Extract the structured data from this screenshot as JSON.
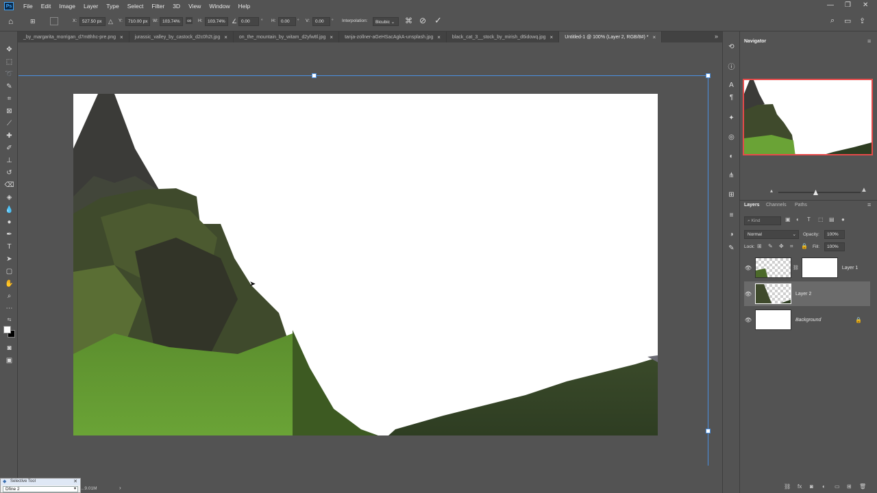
{
  "app": {
    "logo_text": "Ps"
  },
  "menu": [
    "File",
    "Edit",
    "Image",
    "Layer",
    "Type",
    "Select",
    "Filter",
    "3D",
    "View",
    "Window",
    "Help"
  ],
  "options": {
    "x_label": "X:",
    "x_value": "527.50 px",
    "y_label": "Y:",
    "y_value": "710.00 px",
    "w_label": "W:",
    "w_value": "103.74%",
    "h_label": "H:",
    "h_value": "103.74%",
    "angle_value": "0.00",
    "h_skew_label": "H:",
    "h_skew_value": "0.00",
    "v_skew_label": "V:",
    "v_skew_value": "0.00",
    "interpolation_label": "Interpolation:",
    "interpolation_value": "Bicubic"
  },
  "tabs": [
    {
      "label": "_by_margarita_morrigan_d7m8hhc-pre.png",
      "active": false
    },
    {
      "label": "jurassic_valley_by_castock_d2c0h2t.jpg",
      "active": false
    },
    {
      "label": "on_the_mountain_by_witam_d2yfw8l.jpg",
      "active": false
    },
    {
      "label": "tanja-zollner-aGeHSacAgkA-unsplash.jpg",
      "active": false
    },
    {
      "label": "black_cat_3__stock_by_mirish_d6idowq.jpg",
      "active": false
    },
    {
      "label": "Untitled-1 @ 100% (Layer 2, RGB/8#) *",
      "active": true
    }
  ],
  "navigator": {
    "title": "Navigator"
  },
  "layers_panel": {
    "tabs": [
      "Layers",
      "Channels",
      "Paths"
    ],
    "kind_placeholder": "Kind",
    "blend_mode": "Normal",
    "opacity_label": "Opacity:",
    "opacity_value": "100%",
    "lock_label": "Lock:",
    "fill_label": "Fill:",
    "fill_value": "100%",
    "layers": [
      {
        "name": "Layer 1",
        "selected": false
      },
      {
        "name": "Layer 2",
        "selected": true
      },
      {
        "name": "Background",
        "selected": false
      }
    ]
  },
  "status": {
    "doc_size": "...9.01M"
  },
  "selective_tool": {
    "title": "Selective Tool",
    "input_value": "Dfine 2"
  },
  "colors": {
    "ui_bg": "#535353",
    "selection_line": "#4a90e2",
    "navigator_frame": "#e84a4a"
  }
}
